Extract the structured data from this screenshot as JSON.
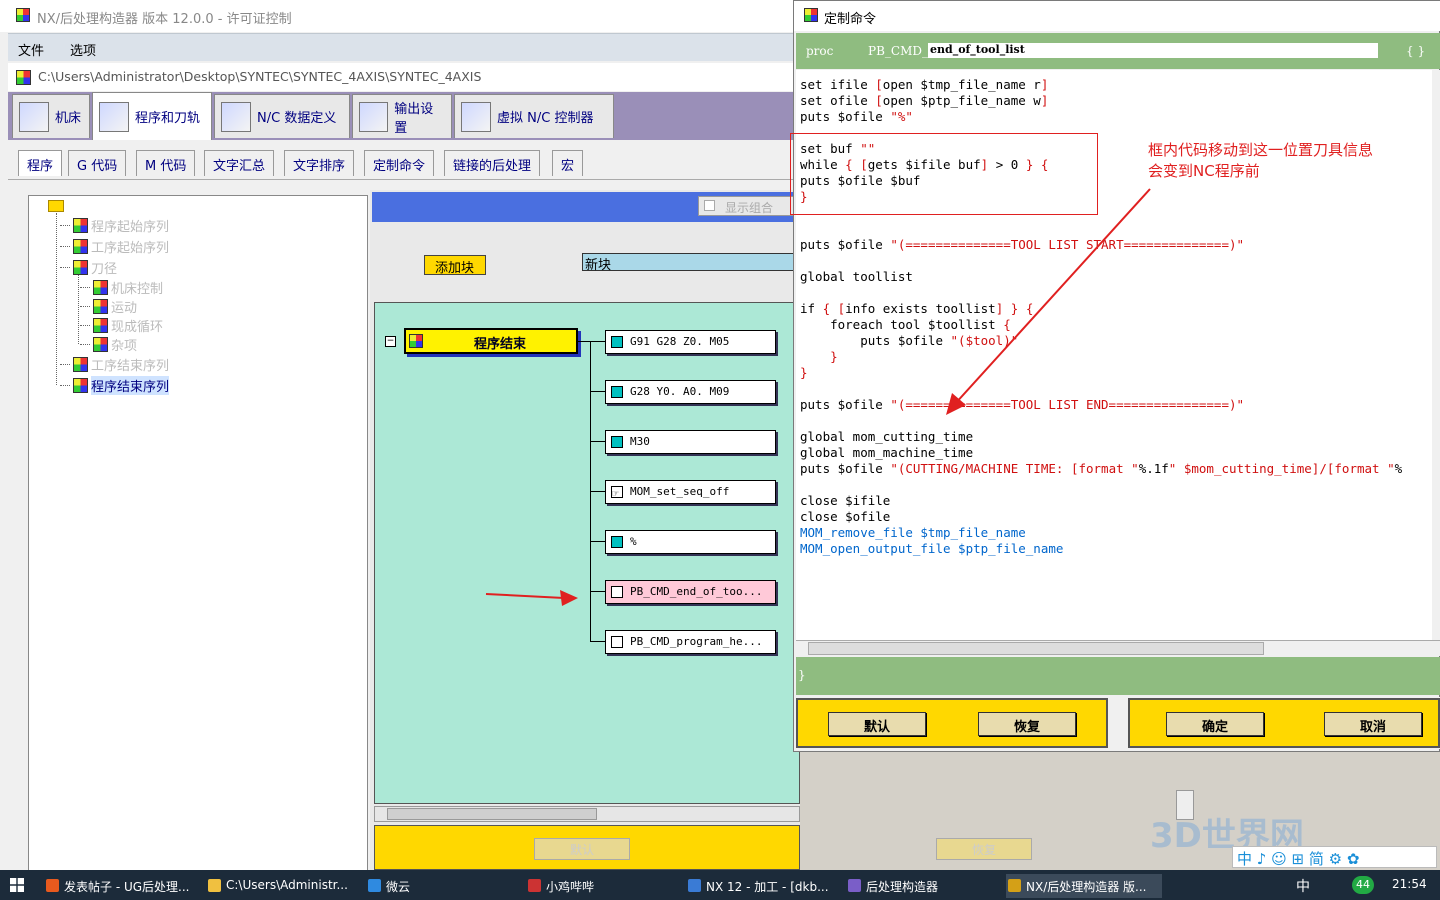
{
  "main_window": {
    "title": "NX/后处理构造器 版本 12.0.0 - 许可证控制",
    "menu": [
      "文件",
      "选项"
    ],
    "path": "C:\\Users\\Administrator\\Desktop\\SYNTEC\\SYNTEC_4AXIS\\SYNTEC_4AXIS",
    "tabs": [
      {
        "label": "机床",
        "active": false
      },
      {
        "label": "程序和刀轨",
        "active": true
      },
      {
        "label": "N/C 数据定义",
        "active": false
      },
      {
        "label": "输出设置",
        "active": false
      },
      {
        "label": "虚拟 N/C 控制器",
        "active": false
      }
    ],
    "subtabs": [
      {
        "label": "程序",
        "active": true
      },
      {
        "label": "G 代码",
        "active": false
      },
      {
        "label": "M 代码",
        "active": false
      },
      {
        "label": "文字汇总",
        "active": false
      },
      {
        "label": "文字排序",
        "active": false
      },
      {
        "label": "定制命令",
        "active": false
      },
      {
        "label": "链接的后处理",
        "active": false
      },
      {
        "label": "宏",
        "active": false
      }
    ],
    "tree": [
      {
        "label": "程序起始序列",
        "level": 1,
        "selected": false
      },
      {
        "label": "工序起始序列",
        "level": 1,
        "selected": false
      },
      {
        "label": "刀径",
        "level": 1,
        "selected": false
      },
      {
        "label": "机床控制",
        "level": 2,
        "selected": false
      },
      {
        "label": "运动",
        "level": 2,
        "selected": false
      },
      {
        "label": "现成循环",
        "level": 2,
        "selected": false
      },
      {
        "label": "杂项",
        "level": 2,
        "selected": false
      },
      {
        "label": "工序结束序列",
        "level": 1,
        "selected": false
      },
      {
        "label": "程序结束序列",
        "level": 1,
        "selected": true
      }
    ],
    "show_combo": "显示组合",
    "add_block": "添加块",
    "new_block": "新块",
    "program_end": "程序结束",
    "blocks": [
      {
        "text": "G91 G28 Z0. M05",
        "icon": "block",
        "highlight": false
      },
      {
        "text": "G28 Y0. A0. M09",
        "icon": "block",
        "highlight": false
      },
      {
        "text": "M30",
        "icon": "block",
        "highlight": false
      },
      {
        "text": "MOM_set_seq_off",
        "icon": "hand",
        "highlight": false
      },
      {
        "text": "%",
        "icon": "block",
        "highlight": false
      },
      {
        "text": "PB_CMD_end_of_too...",
        "icon": "hand",
        "highlight": true
      },
      {
        "text": "PB_CMD_program_he...",
        "icon": "hand",
        "highlight": false
      }
    ],
    "bottom_buttons": [
      "默认",
      "恢复"
    ]
  },
  "dialog": {
    "title": "定制命令",
    "proc_label": "proc",
    "proc_prefix": "PB_CMD_",
    "proc_name": "end_of_tool_list",
    "open_brace": "{ }",
    "close_brace": "}",
    "code": [
      "set ifile [open $tmp_file_name r]",
      "set ofile [open $ptp_file_name w]",
      "puts $ofile \"%\"",
      "",
      "set buf \"\"",
      "while { [gets $ifile buf] > 0 } {",
      "puts $ofile $buf",
      "}",
      "",
      "",
      "puts $ofile \"(==============TOOL LIST START==============)\"",
      "",
      "global toollist",
      "",
      "if { [info exists toollist] } {",
      "    foreach tool $toollist {",
      "        puts $ofile \"($tool)\"",
      "    }",
      "}",
      "",
      "puts $ofile \"(==============TOOL LIST END================)\"",
      "",
      "global mom_cutting_time",
      "global mom_machine_time",
      "puts $ofile \"(CUTTING/MACHINE TIME: [format \"%.1f\" $mom_cutting_time]/[format \"%",
      "",
      "close $ifile",
      "close $ofile",
      "MOM_remove_file $tmp_file_name",
      "MOM_open_output_file $ptp_file_name"
    ],
    "annotation": [
      "框内代码移动到这一位置刀具信息",
      "会变到NC程序前"
    ],
    "buttons": [
      "默认",
      "恢复",
      "确定",
      "取消"
    ]
  },
  "taskbar": {
    "items": [
      {
        "label": "发表帖子 - UG后处理...",
        "color": "#e85a1e"
      },
      {
        "label": "C:\\Users\\Administr...",
        "color": "#f0c040"
      },
      {
        "label": "微云",
        "color": "#2f8ae0"
      },
      {
        "label": "小鸡哔哔",
        "color": "#cc3333"
      },
      {
        "label": "NX 12 - 加工 - [dkb...",
        "color": "#3a7bd5"
      },
      {
        "label": "后处理构造器",
        "color": "#7a5ec8"
      },
      {
        "label": "NX/后处理构造器 版...",
        "color": "#d4a017"
      }
    ],
    "tray_lang": "中",
    "badge": "44",
    "clock": "21:54"
  },
  "watermark": "3D世界网",
  "ime": "中 ♪ ☺ ⊞ 简 ⚙ ✿",
  "colors": {
    "accent_yellow": "#ffd800",
    "canvas_green": "#ace8d6",
    "header_blue": "#4a6fe0",
    "proc_green": "#8fbc80",
    "annotation_red": "#e02020"
  }
}
